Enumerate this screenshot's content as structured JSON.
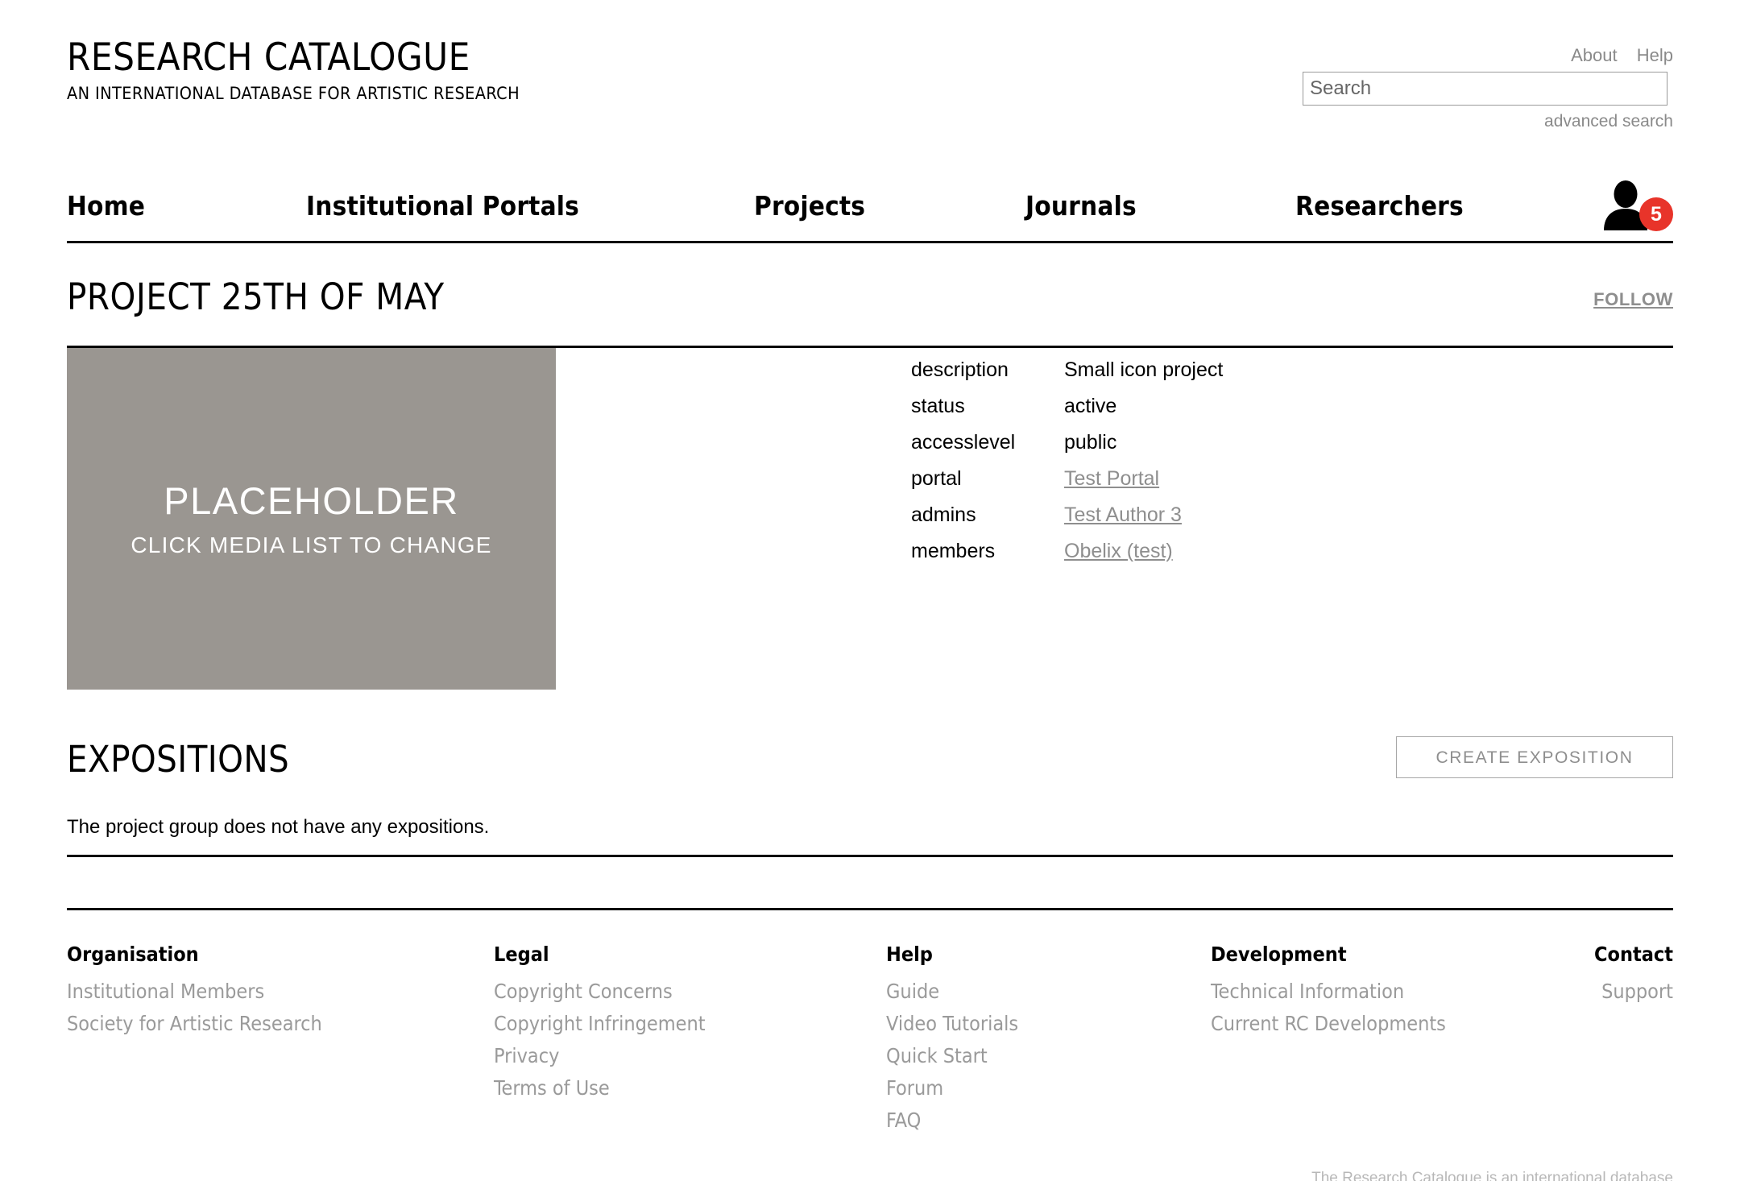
{
  "brand": {
    "title": "RESEARCH CATALOGUE",
    "subtitle": "AN INTERNATIONAL DATABASE FOR ARTISTIC RESEARCH"
  },
  "header": {
    "about_label": "About",
    "help_label": "Help",
    "search_placeholder": "Search",
    "search_value": "",
    "advanced_search_label": "advanced search",
    "user_badge_count": "5",
    "badge_color": "#e8342a"
  },
  "nav": {
    "items": [
      {
        "label": "Home"
      },
      {
        "label": "Institutional Portals"
      },
      {
        "label": "Projects"
      },
      {
        "label": "Journals"
      },
      {
        "label": "Researchers"
      }
    ]
  },
  "project": {
    "title": "PROJECT 25TH OF MAY",
    "follow_label": "FOLLOW",
    "placeholder": {
      "line1": "PLACEHOLDER",
      "line2": "CLICK MEDIA LIST TO CHANGE",
      "bg_color": "#9a9691"
    },
    "meta": [
      {
        "key": "description",
        "value": "Small icon project",
        "is_link": false
      },
      {
        "key": "status",
        "value": "active",
        "is_link": false
      },
      {
        "key": "accesslevel",
        "value": "public",
        "is_link": false
      },
      {
        "key": "portal",
        "value": "Test Portal",
        "is_link": true
      },
      {
        "key": "admins",
        "value": "Test Author 3",
        "is_link": true
      },
      {
        "key": "members",
        "value": "Obelix (test)",
        "is_link": true
      }
    ]
  },
  "expositions": {
    "title": "EXPOSITIONS",
    "create_label": "CREATE EXPOSITION",
    "empty_message": "The project group does not have any expositions."
  },
  "footer": {
    "columns": [
      {
        "heading": "Organisation",
        "links": [
          "Institutional Members",
          "Society for Artistic Research"
        ]
      },
      {
        "heading": "Legal",
        "links": [
          "Copyright Concerns",
          "Copyright Infringement",
          "Privacy",
          "Terms of Use"
        ]
      },
      {
        "heading": "Help",
        "links": [
          "Guide",
          "Video Tutorials",
          "Quick Start",
          "Forum",
          "FAQ"
        ]
      },
      {
        "heading": "Development",
        "links": [
          "Technical Information",
          "Current RC Developments"
        ]
      },
      {
        "heading": "Contact",
        "links": [
          "Support"
        ]
      }
    ],
    "note": "The Research Catalogue is an international database"
  }
}
